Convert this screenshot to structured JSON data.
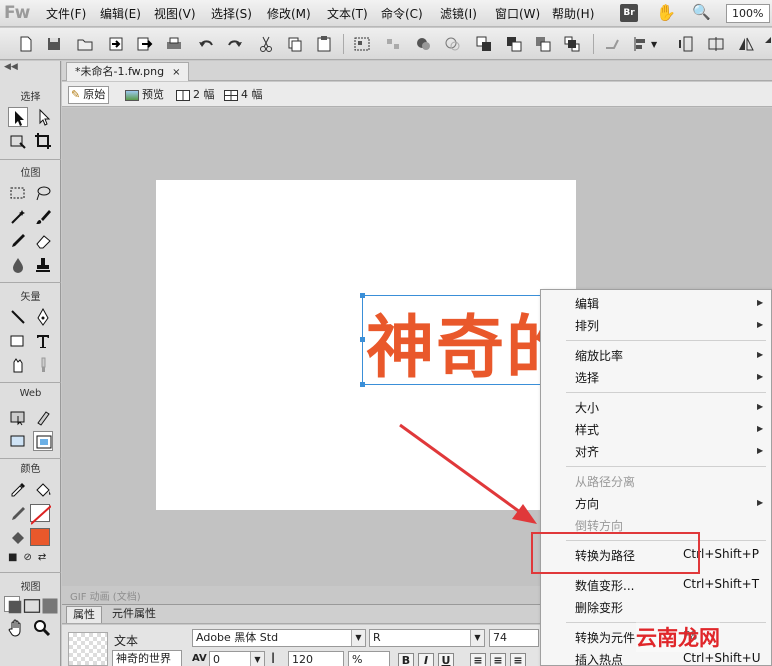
{
  "app": {
    "logo": "Fw",
    "br_badge": "Br",
    "zoom": "100%"
  },
  "menubar": [
    "文件(F)",
    "编辑(E)",
    "视图(V)",
    "选择(S)",
    "修改(M)",
    "文本(T)",
    "命令(C)",
    "滤镜(I)",
    "窗口(W)",
    "帮助(H)"
  ],
  "tools": {
    "sections": [
      "选择",
      "位图",
      "矢量",
      "Web",
      "颜色",
      "视图"
    ]
  },
  "document": {
    "tab_title": "*未命名-1.fw.png",
    "tab_close": "×",
    "views": [
      "原始",
      "预览",
      "2 幅",
      "4 幅"
    ],
    "canvas_text": "神奇的世界",
    "status": "GIF 动画 (文档)"
  },
  "properties": {
    "tabs": [
      "属性",
      "元件属性"
    ],
    "object_type": "文本",
    "object_name": "神奇的世界",
    "font_family": "Adobe 黑体 Std",
    "font_style": "R",
    "font_size": "74",
    "kerning": "0",
    "leading": "120",
    "leading_unit": "%",
    "av_label": "AV",
    "format_buttons": [
      "B",
      "I",
      "U"
    ]
  },
  "context_menu": {
    "items": [
      {
        "label": "编辑",
        "submenu": true,
        "disabled": false,
        "shortcut": ""
      },
      {
        "label": "排列",
        "submenu": true,
        "disabled": false,
        "shortcut": ""
      },
      {
        "label": "缩放比率",
        "submenu": true,
        "disabled": false,
        "shortcut": ""
      },
      {
        "label": "选择",
        "submenu": true,
        "disabled": false,
        "shortcut": ""
      },
      {
        "label": "大小",
        "submenu": true,
        "disabled": false,
        "shortcut": ""
      },
      {
        "label": "样式",
        "submenu": true,
        "disabled": false,
        "shortcut": ""
      },
      {
        "label": "对齐",
        "submenu": true,
        "disabled": false,
        "shortcut": ""
      },
      {
        "label": "从路径分离",
        "submenu": false,
        "disabled": true,
        "shortcut": ""
      },
      {
        "label": "方向",
        "submenu": true,
        "disabled": false,
        "shortcut": ""
      },
      {
        "label": "倒转方向",
        "submenu": false,
        "disabled": true,
        "shortcut": ""
      },
      {
        "label": "转换为路径",
        "submenu": false,
        "disabled": false,
        "shortcut": "Ctrl+Shift+P"
      },
      {
        "label": "数值变形...",
        "submenu": false,
        "disabled": false,
        "shortcut": "Ctrl+Shift+T"
      },
      {
        "label": "删除变形",
        "submenu": false,
        "disabled": false,
        "shortcut": ""
      },
      {
        "label": "转换为元件",
        "submenu": false,
        "disabled": false,
        "shortcut": "F8"
      },
      {
        "label": "插入热点",
        "submenu": false,
        "disabled": false,
        "shortcut": "Ctrl+Shift+U"
      }
    ]
  },
  "watermark": "云南龙网",
  "colors": {
    "text_fill": "#e9582b",
    "highlight": "#e0383a",
    "selection": "#3a8fd8"
  }
}
